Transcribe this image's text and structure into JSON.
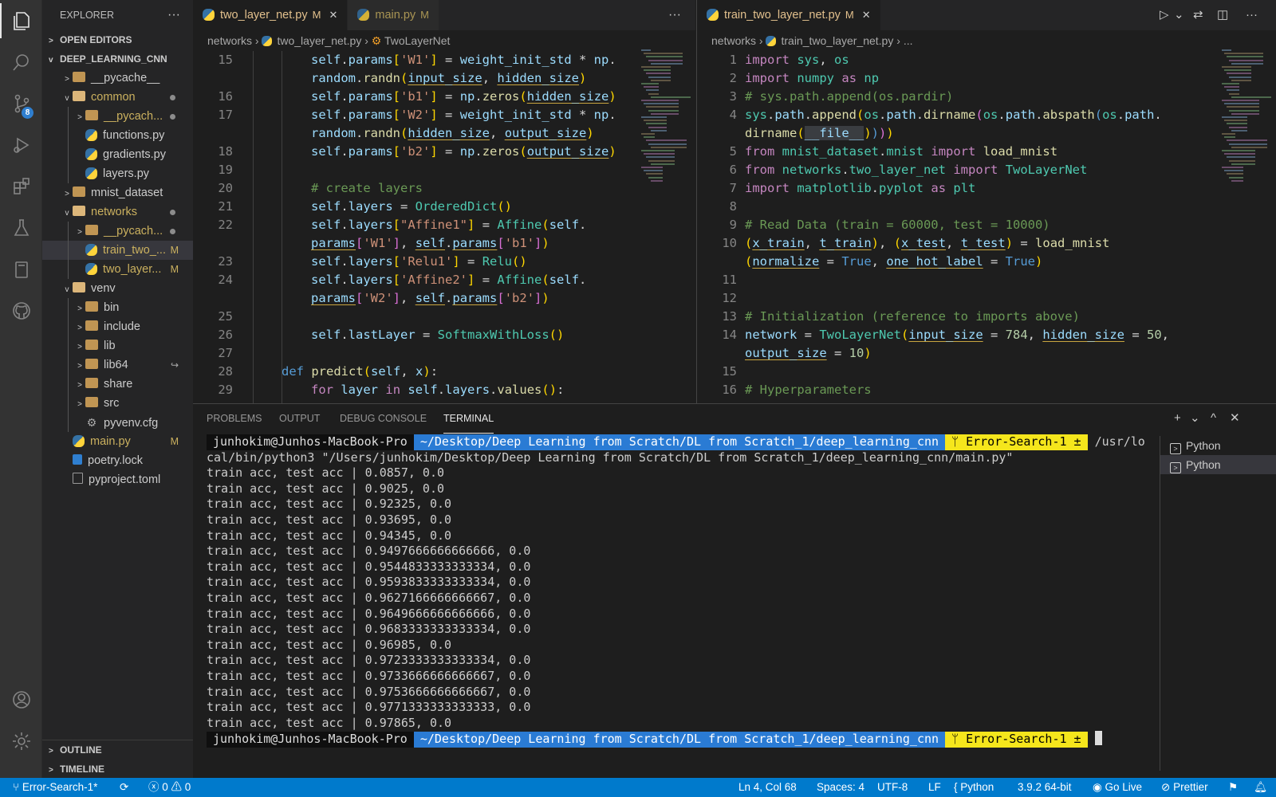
{
  "colors": {
    "accent": "#007acc",
    "modified": "#cbb15f",
    "folder": "#dcb67a",
    "prompt_blue": "#2a7bd4",
    "prompt_yellow": "#f5e61c"
  },
  "activity_bar": {
    "items": [
      "files-icon",
      "search-icon",
      "source-control-icon",
      "run-debug-icon",
      "extensions-icon",
      "testing-icon",
      "notebook-icon",
      "github-icon"
    ],
    "scm_badge": "8",
    "bottom": [
      "account-icon",
      "settings-gear-icon"
    ]
  },
  "sidebar": {
    "title": "EXPLORER",
    "more": "···",
    "open_editors": "OPEN EDITORS",
    "project": "DEEP_LEARNING_CNN",
    "tree": [
      {
        "label": "__pycache__",
        "type": "folder",
        "depth": 1,
        "twisty": ">"
      },
      {
        "label": "common",
        "type": "folder-open",
        "depth": 1,
        "twisty": "v",
        "dot": true,
        "mod": true
      },
      {
        "label": "__pycach...",
        "type": "folder",
        "depth": 2,
        "twisty": ">",
        "dot": true,
        "mod": true
      },
      {
        "label": "functions.py",
        "type": "py",
        "depth": 2
      },
      {
        "label": "gradients.py",
        "type": "py",
        "depth": 2
      },
      {
        "label": "layers.py",
        "type": "py",
        "depth": 2
      },
      {
        "label": "mnist_dataset",
        "type": "folder",
        "depth": 1,
        "twisty": ">"
      },
      {
        "label": "networks",
        "type": "folder-open",
        "depth": 1,
        "twisty": "v",
        "dot": true,
        "mod": true
      },
      {
        "label": "__pycach...",
        "type": "folder",
        "depth": 2,
        "twisty": ">",
        "dot": true,
        "mod": true
      },
      {
        "label": "train_two_...",
        "type": "py",
        "depth": 2,
        "badge": "M",
        "selected": true,
        "mod": true
      },
      {
        "label": "two_layer...",
        "type": "py",
        "depth": 2,
        "badge": "M",
        "mod": true
      },
      {
        "label": "venv",
        "type": "folder-open",
        "depth": 1,
        "twisty": "v"
      },
      {
        "label": "bin",
        "type": "folder",
        "depth": 2,
        "twisty": ">"
      },
      {
        "label": "include",
        "type": "folder",
        "depth": 2,
        "twisty": ">"
      },
      {
        "label": "lib",
        "type": "folder",
        "depth": 2,
        "twisty": ">"
      },
      {
        "label": "lib64",
        "type": "folder",
        "depth": 2,
        "twisty": ">",
        "link": "↪"
      },
      {
        "label": "share",
        "type": "folder",
        "depth": 2,
        "twisty": ">"
      },
      {
        "label": "src",
        "type": "folder",
        "depth": 2,
        "twisty": ">"
      },
      {
        "label": "pyvenv.cfg",
        "type": "cfg",
        "depth": 2
      },
      {
        "label": "main.py",
        "type": "py",
        "depth": 1,
        "badge": "M",
        "mod": true
      },
      {
        "label": "poetry.lock",
        "type": "lock",
        "depth": 1
      },
      {
        "label": "pyproject.toml",
        "type": "toml",
        "depth": 1
      }
    ],
    "outline": "OUTLINE",
    "timeline": "TIMELINE"
  },
  "editor_left": {
    "tabs": [
      {
        "label": "two_layer_net.py",
        "mod": "M",
        "active": true,
        "close": "✕"
      },
      {
        "label": "main.py",
        "mod": "M",
        "active": false
      }
    ],
    "more": "···",
    "breadcrumb": [
      "networks",
      "two_layer_net.py",
      "TwoLayerNet"
    ],
    "lines": [
      {
        "n": "15",
        "ind": 2,
        "html": "<span class='v'>self</span><span class='w'>.</span><span class='v'>params</span><span class='y'>[</span><span class='s'>'W1'</span><span class='y'>]</span><span class='w'> = </span><span class='v'>weight_init_std</span><span class='w'> * </span><span class='v'>np</span><span class='w'>.</span>"
      },
      {
        "n": "",
        "ind": 2,
        "html": "<span class='v'>random</span><span class='w'>.</span><span class='f'>randn</span><span class='y'>(</span><span class='v u'>input_size</span><span class='w'>, </span><span class='v u'>hidden_size</span><span class='y'>)</span>"
      },
      {
        "n": "16",
        "ind": 2,
        "html": "<span class='v'>self</span><span class='w'>.</span><span class='v'>params</span><span class='y'>[</span><span class='s'>'b1'</span><span class='y'>]</span><span class='w'> = </span><span class='v'>np</span><span class='w'>.</span><span class='f'>zeros</span><span class='y'>(</span><span class='v u'>hidden_size</span><span class='y'>)</span>"
      },
      {
        "n": "17",
        "ind": 2,
        "html": "<span class='v'>self</span><span class='w'>.</span><span class='v'>params</span><span class='y'>[</span><span class='s'>'W2'</span><span class='y'>]</span><span class='w'> = </span><span class='v'>weight_init_std</span><span class='w'> * </span><span class='v'>np</span><span class='w'>.</span>"
      },
      {
        "n": "",
        "ind": 2,
        "html": "<span class='v'>random</span><span class='w'>.</span><span class='f'>randn</span><span class='y'>(</span><span class='v u'>hidden_size</span><span class='w'>, </span><span class='v u'>output_size</span><span class='y'>)</span>"
      },
      {
        "n": "18",
        "ind": 2,
        "html": "<span class='v'>self</span><span class='w'>.</span><span class='v'>params</span><span class='y'>[</span><span class='s'>'b2'</span><span class='y'>]</span><span class='w'> = </span><span class='v'>np</span><span class='w'>.</span><span class='f'>zeros</span><span class='y'>(</span><span class='v u'>output_size</span><span class='y'>)</span>"
      },
      {
        "n": "19",
        "ind": 2,
        "html": ""
      },
      {
        "n": "20",
        "ind": 2,
        "html": "<span class='c'># create layers</span>"
      },
      {
        "n": "21",
        "ind": 2,
        "html": "<span class='v'>self</span><span class='w'>.</span><span class='v'>layers</span><span class='w'> = </span><span class='cl'>OrderedDict</span><span class='y'>()</span>"
      },
      {
        "n": "22",
        "ind": 2,
        "html": "<span class='v'>self</span><span class='w'>.</span><span class='v'>layers</span><span class='y'>[</span><span class='s'>\"Affine1\"</span><span class='y'>]</span><span class='w'> = </span><span class='cl'>Affine</span><span class='y'>(</span><span class='v'>self</span><span class='w'>.</span>"
      },
      {
        "n": "",
        "ind": 2,
        "html": "<span class='v u'>params</span><span class='pk'>[</span><span class='s'>'W1'</span><span class='pk'>]</span><span class='w'>, </span><span class='v u'>self</span><span class='w'>.</span><span class='v u'>params</span><span class='pk'>[</span><span class='s'>'b1'</span><span class='pk'>]</span><span class='y'>)</span>"
      },
      {
        "n": "23",
        "ind": 2,
        "html": "<span class='v'>self</span><span class='w'>.</span><span class='v'>layers</span><span class='y'>[</span><span class='s'>'Relu1'</span><span class='y'>]</span><span class='w'> = </span><span class='cl'>Relu</span><span class='y'>()</span>"
      },
      {
        "n": "24",
        "ind": 2,
        "html": "<span class='v'>self</span><span class='w'>.</span><span class='v'>layers</span><span class='y'>[</span><span class='s'>'Affine2'</span><span class='y'>]</span><span class='w'> = </span><span class='cl'>Affine</span><span class='y'>(</span><span class='v'>self</span><span class='w'>.</span>"
      },
      {
        "n": "",
        "ind": 2,
        "html": "<span class='v u'>params</span><span class='pk'>[</span><span class='s'>'W2'</span><span class='pk'>]</span><span class='w'>, </span><span class='v u'>self</span><span class='w'>.</span><span class='v u'>params</span><span class='pk'>[</span><span class='s'>'b2'</span><span class='pk'>]</span><span class='y'>)</span>"
      },
      {
        "n": "25",
        "ind": 2,
        "html": ""
      },
      {
        "n": "26",
        "ind": 2,
        "html": "<span class='v'>self</span><span class='w'>.</span><span class='v'>lastLayer</span><span class='w'> = </span><span class='cl'>SoftmaxWithLoss</span><span class='y'>()</span>"
      },
      {
        "n": "27",
        "ind": 1,
        "html": ""
      },
      {
        "n": "28",
        "ind": 1,
        "html": "<span class='kb'>def</span><span class='w'> </span><span class='f'>predict</span><span class='y'>(</span><span class='v'>self</span><span class='w'>, </span><span class='v'>x</span><span class='y'>)</span><span class='w'>:</span>"
      },
      {
        "n": "29",
        "ind": 2,
        "html": "<span class='k'>for</span><span class='w'> </span><span class='v'>layer</span><span class='w'> </span><span class='k'>in</span><span class='w'> </span><span class='v'>self</span><span class='w'>.</span><span class='v'>layers</span><span class='w'>.</span><span class='f'>values</span><span class='y'>()</span><span class='w'>:</span>"
      }
    ]
  },
  "editor_right": {
    "tabs": [
      {
        "label": "train_two_layer_net.py",
        "mod": "M",
        "active": true,
        "close": "✕"
      }
    ],
    "actions": [
      "run-icon",
      "dropdown-icon",
      "compare-icon",
      "split-editor-icon",
      "more-icon"
    ],
    "breadcrumb": [
      "networks",
      "train_two_layer_net.py",
      "..."
    ],
    "lines": [
      {
        "n": "1",
        "html": "<span class='k'>import</span><span class='w'> </span><span class='cl'>sys</span><span class='w'>, </span><span class='cl'>os</span>"
      },
      {
        "n": "2",
        "html": "<span class='k'>import</span><span class='w'> </span><span class='cl'>numpy</span><span class='w'> </span><span class='k'>as</span><span class='w'> </span><span class='cl'>np</span>"
      },
      {
        "n": "3",
        "html": "<span class='c'># sys.path.append(os.pardir)</span>"
      },
      {
        "n": "4",
        "html": "<span class='cl'>sys</span><span class='w'>.</span><span class='v'>path</span><span class='w'>.</span><span class='f'>append</span><span class='y'>(</span><span class='cl'>os</span><span class='w'>.</span><span class='v'>path</span><span class='w'>.</span><span class='f'>dirname</span><span class='pk'>(</span><span class='cl'>os</span><span class='w'>.</span><span class='v'>path</span><span class='w'>.</span><span class='f'>abspath</span><span class='kb'>(</span><span class='cl'>os</span><span class='w'>.</span><span class='v'>path</span><span class='w'>.</span>"
      },
      {
        "n": "",
        "html": "<span class='f'>dirname</span><span class='y'>(</span><span class='v' style='background:#3a3d41'>__file__</span><span class='y'>)</span><span class='kb'>)</span><span class='pk'>)</span><span class='y'>)</span>"
      },
      {
        "n": "5",
        "html": "<span class='k'>from</span><span class='w'> </span><span class='cl'>mnist_dataset</span><span class='w'>.</span><span class='cl'>mnist</span><span class='w'> </span><span class='k'>import</span><span class='w'> </span><span class='f'>load_mnist</span>"
      },
      {
        "n": "6",
        "html": "<span class='k'>from</span><span class='w'> </span><span class='cl'>networks</span><span class='w'>.</span><span class='cl'>two_layer_net</span><span class='w'> </span><span class='k'>import</span><span class='w'> </span><span class='cl'>TwoLayerNet</span>"
      },
      {
        "n": "7",
        "html": "<span class='k'>import</span><span class='w'> </span><span class='cl'>matplotlib</span><span class='w'>.</span><span class='cl'>pyplot</span><span class='w'> </span><span class='k'>as</span><span class='w'> </span><span class='cl'>plt</span>"
      },
      {
        "n": "8",
        "html": ""
      },
      {
        "n": "9",
        "html": "<span class='c'># Read Data (train = 60000, test = 10000)</span>"
      },
      {
        "n": "10",
        "html": "<span class='y'>(</span><span class='v u'>x_train</span><span class='w'>, </span><span class='v u'>t_train</span><span class='y'>)</span><span class='w'>, </span><span class='y'>(</span><span class='v u'>x_test</span><span class='w'>, </span><span class='v u'>t_test</span><span class='y'>)</span><span class='w'> = </span><span class='f'>load_mnist</span>"
      },
      {
        "n": "",
        "html": "<span class='y'>(</span><span class='v u'>normalize</span><span class='w'> = </span><span class='kb'>True</span><span class='w'>, </span><span class='v u'>one_hot_label</span><span class='w'> = </span><span class='kb'>True</span><span class='y'>)</span>"
      },
      {
        "n": "11",
        "html": ""
      },
      {
        "n": "12",
        "html": ""
      },
      {
        "n": "13",
        "html": "<span class='c'># Initialization (reference to imports above)</span>"
      },
      {
        "n": "14",
        "html": "<span class='v'>network</span><span class='w'> = </span><span class='cl'>TwoLayerNet</span><span class='y'>(</span><span class='v u'>input_size</span><span class='w'> = </span><span class='nu'>784</span><span class='w'>, </span><span class='v u'>hidden_size</span><span class='w'> = </span><span class='nu'>50</span><span class='w'>,</span>"
      },
      {
        "n": "",
        "html": "<span class='v u'>output_size</span><span class='w'> = </span><span class='nu'>10</span><span class='y'>)</span>"
      },
      {
        "n": "15",
        "html": ""
      },
      {
        "n": "16",
        "html": "<span class='c'># Hyperparameters</span>"
      }
    ]
  },
  "panel": {
    "tabs": [
      "PROBLEMS",
      "OUTPUT",
      "DEBUG CONSOLE",
      "TERMINAL"
    ],
    "active": "TERMINAL",
    "controls": [
      "+",
      "⌄",
      "^",
      "✕"
    ],
    "prompt": {
      "user": "junhokim@Junhos-MacBook-Pro",
      "path": "~/Desktop/Deep Learning from Scratch/DL from Scratch_1/deep_learning_cnn",
      "branch": "ᛘ Error-Search-1 ±"
    },
    "command_tail": " /usr/lo",
    "command_wrap": "cal/bin/python3 \"/Users/junhokim/Desktop/Deep Learning from Scratch/DL from Scratch_1/deep_learning_cnn/main.py\"",
    "output": [
      "train acc, test acc | 0.0857, 0.0",
      "train acc, test acc | 0.9025, 0.0",
      "train acc, test acc | 0.92325, 0.0",
      "train acc, test acc | 0.93695, 0.0",
      "train acc, test acc | 0.94345, 0.0",
      "train acc, test acc | 0.9497666666666666, 0.0",
      "train acc, test acc | 0.9544833333333334, 0.0",
      "train acc, test acc | 0.9593833333333334, 0.0",
      "train acc, test acc | 0.9627166666666667, 0.0",
      "train acc, test acc | 0.9649666666666666, 0.0",
      "train acc, test acc | 0.9683333333333334, 0.0",
      "train acc, test acc | 0.96985, 0.0",
      "train acc, test acc | 0.9723333333333334, 0.0",
      "train acc, test acc | 0.9733666666666667, 0.0",
      "train acc, test acc | 0.9753666666666667, 0.0",
      "train acc, test acc | 0.9771333333333333, 0.0",
      "train acc, test acc | 0.97865, 0.0"
    ],
    "terminals": [
      "Python",
      "Python"
    ]
  },
  "status": {
    "branch": "Error-Search-1*",
    "sync": "⟳",
    "errors": "0",
    "warnings": "0",
    "position": "Ln 4, Col 68",
    "spaces": "Spaces: 4",
    "encoding": "UTF-8",
    "eol": "LF",
    "language": "Python",
    "interpreter": "3.9.2 64-bit",
    "golive": "Go Live",
    "prettier": "Prettier"
  }
}
